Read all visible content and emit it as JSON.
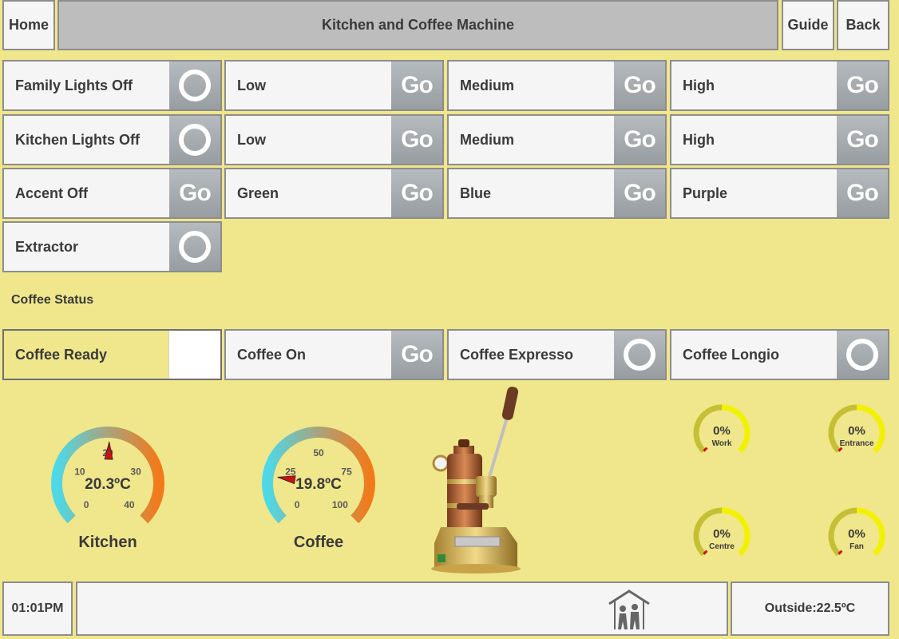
{
  "header": {
    "home_label": "Home",
    "title": "Kitchen and Coffee Machine",
    "guide_label": "Guide",
    "back_label": "Back"
  },
  "controls": {
    "rows": [
      [
        {
          "label": "Family Lights Off",
          "button": "ring-icon"
        },
        {
          "label": "Low",
          "button": "go",
          "go": "Go"
        },
        {
          "label": "Medium",
          "button": "go",
          "go": "Go"
        },
        {
          "label": "High",
          "button": "go",
          "go": "Go"
        }
      ],
      [
        {
          "label": "Kitchen Lights Off",
          "button": "ring-icon"
        },
        {
          "label": "Low",
          "button": "go",
          "go": "Go"
        },
        {
          "label": "Medium",
          "button": "go",
          "go": "Go"
        },
        {
          "label": "High",
          "button": "go",
          "go": "Go"
        }
      ],
      [
        {
          "label": "Accent Off",
          "button": "go",
          "go": "Go"
        },
        {
          "label": "Green",
          "button": "go",
          "go": "Go"
        },
        {
          "label": "Blue",
          "button": "go",
          "go": "Go"
        },
        {
          "label": "Purple",
          "button": "go",
          "go": "Go"
        }
      ],
      [
        {
          "label": "Extractor",
          "button": "ring-icon"
        }
      ]
    ]
  },
  "coffee": {
    "section_label": "Coffee Status",
    "tiles": [
      {
        "label": "Coffee Ready",
        "button": "blank",
        "state": "active"
      },
      {
        "label": "Coffee On",
        "button": "go",
        "go": "Go"
      },
      {
        "label": "Coffee Expresso",
        "button": "ring-icon"
      },
      {
        "label": "Coffee Longio",
        "button": "ring-icon"
      }
    ]
  },
  "gauges": {
    "kitchen": {
      "name": "Kitchen",
      "value_text": "20.3ºC",
      "value": 20.3,
      "min": 0,
      "max": 40,
      "ticks": [
        "0",
        "10",
        "20",
        "30",
        "40"
      ]
    },
    "coffee": {
      "name": "Coffee",
      "value_text": "19.8ºC",
      "value": 19.8,
      "min": 0,
      "max": 100,
      "ticks": [
        "0",
        "25",
        "50",
        "75",
        "100"
      ]
    }
  },
  "mini_gauges": [
    {
      "name": "Work",
      "value_text": "0%",
      "value": 0
    },
    {
      "name": "Entrance",
      "value_text": "0%",
      "value": 0
    },
    {
      "name": "Centre",
      "value_text": "0%",
      "value": 0
    },
    {
      "name": "Fan",
      "value_text": "0%",
      "value": 0
    }
  ],
  "footer": {
    "time": "01:01PM",
    "outside": "Outside:22.5ºC",
    "home_family_icon": "home-family-icon"
  },
  "colors": {
    "background": "#f0e68c",
    "gauge_cold": "#4dd9e8",
    "gauge_hot": "#f27a1a",
    "needle": "#cc1111",
    "mini_arc": "#f2f200"
  }
}
